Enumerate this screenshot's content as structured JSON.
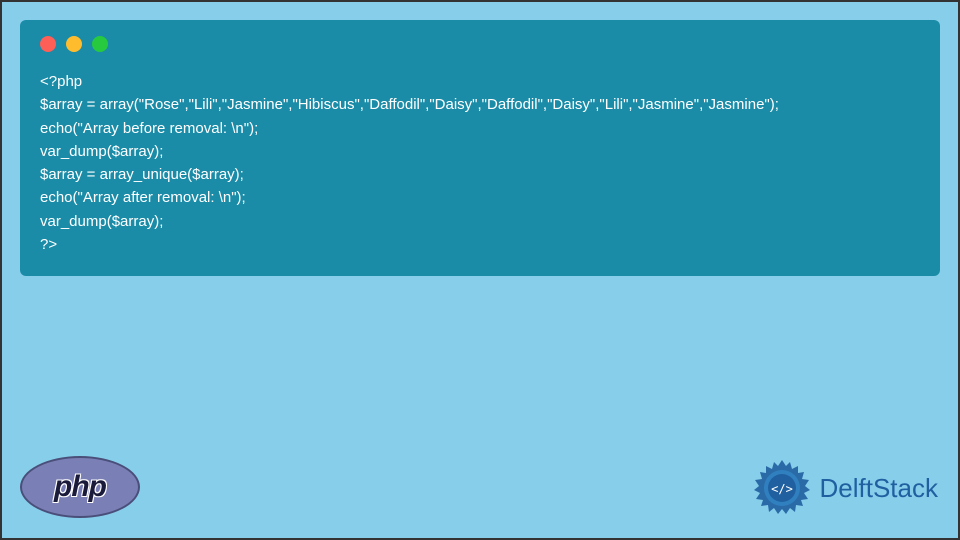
{
  "code": {
    "line1": "<?php",
    "line2": "$array = array(\"Rose\",\"Lili\",\"Jasmine\",\"Hibiscus\",\"Daffodil\",\"Daisy\",\"Daffodil\",\"Daisy\",\"Lili\",\"Jasmine\",\"Jasmine\");",
    "line3": "echo(\"Array before removal: \\n\");",
    "line4": "var_dump($array);",
    "line5": "$array = array_unique($array);",
    "line6": "echo(\"Array after removal: \\n\");",
    "line7": "var_dump($array);",
    "line8": "?>"
  },
  "logos": {
    "php": "php",
    "delftstack": "DelftStack"
  }
}
